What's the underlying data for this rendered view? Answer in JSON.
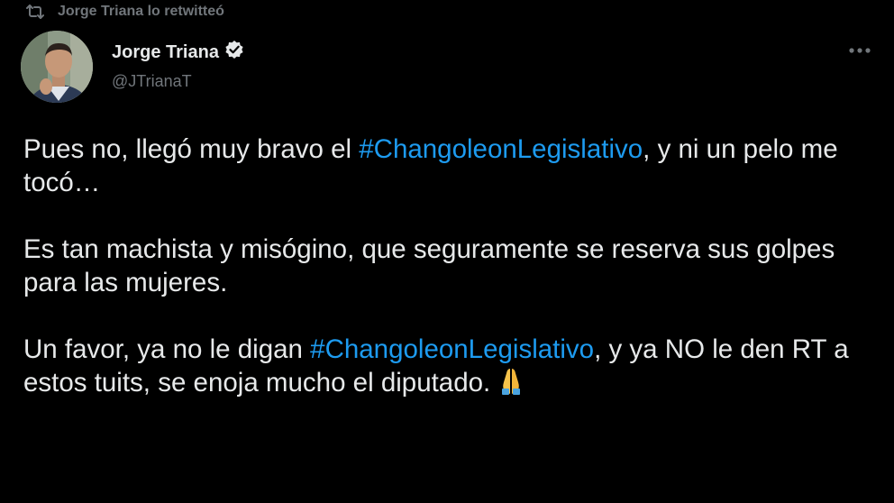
{
  "retweet": {
    "text": "Jorge Triana lo retwitteó",
    "icon": "retweet-icon"
  },
  "author": {
    "name": "Jorge Triana",
    "handle": "@JTrianaT",
    "verified_icon": "verified-badge-icon",
    "avatar_icon": "avatar"
  },
  "menu": {
    "icon": "more-options-icon"
  },
  "tweet": {
    "p1": {
      "before": "Pues no, llegó muy bravo el ",
      "hashtag": "#ChangoleonLegislativo",
      "after": ", y ni un pelo me tocó…"
    },
    "p2": {
      "text": "Es tan machista y misógino, que seguramente se reserva sus golpes para las mujeres."
    },
    "p3": {
      "before": "Un favor, ya no le digan ",
      "hashtag": "#ChangoleonLegislativo",
      "after": ", y ya NO le den RT a estos tuits, se enoja mucho el diputado.",
      "emoji": "🙏"
    }
  },
  "colors": {
    "background": "#000000",
    "text": "#e7e9ea",
    "secondary": "#71767b",
    "link": "#1d9bf0"
  }
}
